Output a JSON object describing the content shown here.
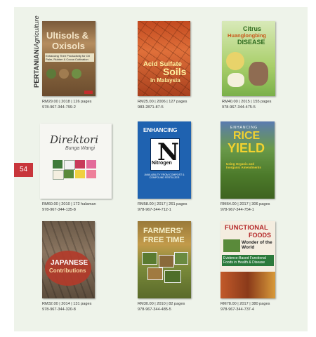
{
  "section": {
    "bold": "PERTANIAN/",
    "italic": "Agriculture"
  },
  "page_number": "54",
  "books": [
    {
      "price": "RM29.00 | 2018 | 126 pages",
      "isbn": "978-967-344-799-2",
      "cover": {
        "title1": "Ultisols &",
        "title2": "Oxisols",
        "subtitle": "Enhancing Their Productivity for Oil Palm, Rubber & Cocoa Cultivation"
      }
    },
    {
      "price": "RM25.00 | 2006 | 127 pages",
      "isbn": "983-2871-87-5",
      "cover": {
        "title1": "Acid Sulfate",
        "title2": "Soils",
        "title3": "in Malaysia"
      }
    },
    {
      "price": "RM40.00 | 2015 | 155 pages",
      "isbn": "978-967-344-475-5",
      "cover": {
        "title1": "Citrus",
        "title2": "Huanglongbing",
        "title3": "DISEASE"
      }
    },
    {
      "price": "RM60.00 | 2010 | 172 halaman",
      "isbn": "978-967-344-135-8",
      "cover": {
        "title1": "Direktori",
        "title2": "Bunga Wangi"
      }
    },
    {
      "price": "RM58.00 | 2017 | 261 pages",
      "isbn": "978-967-344-712-1",
      "cover": {
        "title1": "ENHANCING",
        "symbol": "N",
        "title2": "Nitrogen",
        "subtitle": "AVAILABILITY FROM COMPOST & COMPOUND FERTILIZER"
      }
    },
    {
      "price": "RM64.00 | 2017 | 306 pages",
      "isbn": "978-967-344-754-1",
      "cover": {
        "title0": "ENHANCING",
        "title1": "RICE",
        "title2": "YIELD",
        "subtitle": "Using Organic and Inorganic Amendments"
      }
    },
    {
      "price": "RM32.00 | 2014 | 131 pages",
      "isbn": "978-967-344-320-8",
      "cover": {
        "title1": "JAPANESE",
        "title2": "Contributions"
      }
    },
    {
      "price": "RM30.00 | 2010 | 82 pages",
      "isbn": "978-967-344-485-5",
      "cover": {
        "title1": "FARMERS'",
        "title2": "FREE TIME"
      }
    },
    {
      "price": "RM78.00 | 2017 | 380 pages",
      "isbn": "978-967-344-737-4",
      "cover": {
        "title1": "FUNCTIONAL",
        "title2": "FOODS",
        "title3": "Wonder of the World",
        "subtitle": "Evidence-Based Functional Foods in Health & Disease"
      }
    }
  ]
}
